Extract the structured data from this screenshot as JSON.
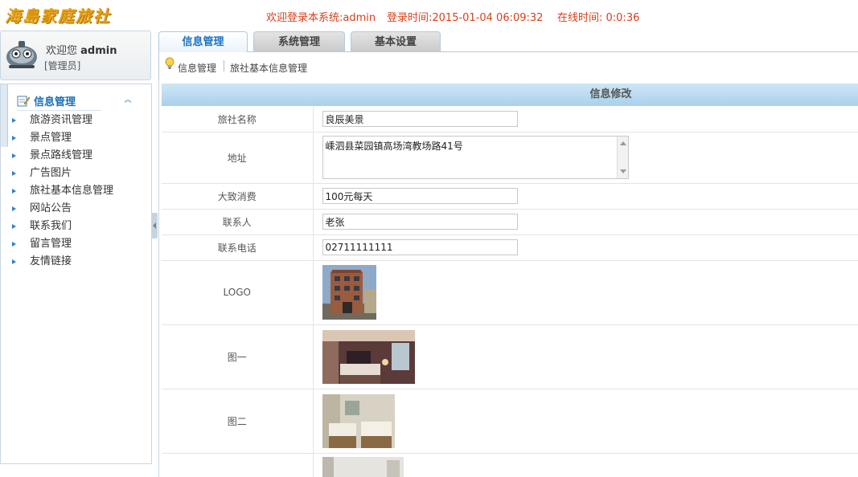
{
  "header": {
    "logo": "海島家庭旅社",
    "welcome": "欢迎登录本系统:admin",
    "login_time": "登录时间:2015-01-04 06:09:32",
    "online_time": "在线时间: 0:0:36"
  },
  "user": {
    "greeting": "欢迎您",
    "name": "admin",
    "role": "[管理员]"
  },
  "sidebar": {
    "section_title": "信息管理",
    "items": [
      {
        "label": "旅游资讯管理"
      },
      {
        "label": "景点管理"
      },
      {
        "label": "景点路线管理"
      },
      {
        "label": "广告图片"
      },
      {
        "label": "旅社基本信息管理"
      },
      {
        "label": "网站公告"
      },
      {
        "label": "联系我们"
      },
      {
        "label": "留言管理"
      },
      {
        "label": "友情链接"
      }
    ]
  },
  "tabs": [
    {
      "label": "信息管理"
    },
    {
      "label": "系统管理"
    },
    {
      "label": "基本设置"
    }
  ],
  "breadcrumb": {
    "first": "信息管理",
    "second": "旅社基本信息管理"
  },
  "form": {
    "title": "信息修改",
    "name_label": "旅社名称",
    "name_value": "良辰美景",
    "address_label": "地址",
    "address_value": "嵊泗县菜园镇高场湾教场路41号",
    "cost_label": "大致消费",
    "cost_value": "100元每天",
    "contact_label": "联系人",
    "contact_value": "老张",
    "phone_label": "联系电话",
    "phone_value": "02711111111",
    "logo_label": "LOGO",
    "pic1_label": "图一",
    "pic2_label": "图二"
  },
  "colors": {
    "header_text": "#d8401a",
    "logo": "#e8a317",
    "accent_blue": "#1b73c2",
    "panel_title_bg": "#a9d0ec"
  }
}
